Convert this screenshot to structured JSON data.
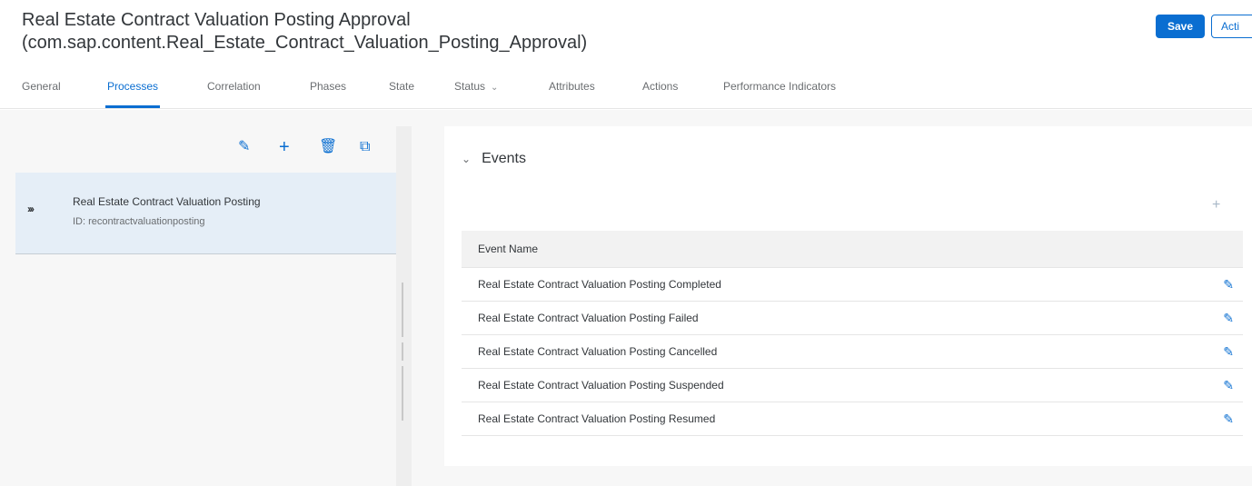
{
  "header": {
    "title_line1": "Real Estate Contract Valuation Posting Approval",
    "title_line2": "(com.sap.content.Real_Estate_Contract_Valuation_Posting_Approval)",
    "save_label": "Save",
    "action_label": "Acti"
  },
  "tabs": [
    {
      "label": "General"
    },
    {
      "label": "Processes"
    },
    {
      "label": "Correlation"
    },
    {
      "label": "Phases"
    },
    {
      "label": "State"
    },
    {
      "label": "Status"
    },
    {
      "label": "Attributes"
    },
    {
      "label": "Actions"
    },
    {
      "label": "Performance Indicators"
    }
  ],
  "active_tab": "Processes",
  "toolbar": {
    "icons": [
      "edit-icon",
      "add-icon",
      "delete-icon",
      "copy-icon"
    ]
  },
  "process": {
    "title": "Real Estate Contract Valuation Posting",
    "id_text": "ID: recontractvaluationposting"
  },
  "events": {
    "section_title": "Events",
    "column_header": "Event Name",
    "rows": [
      "Real Estate Contract Valuation Posting Completed",
      "Real Estate Contract Valuation Posting Failed",
      "Real Estate Contract Valuation Posting Cancelled",
      "Real Estate Contract Valuation Posting Suspended",
      "Real Estate Contract Valuation Posting Resumed"
    ]
  },
  "colors": {
    "accent": "#0a6ed1",
    "selected_row": "#e5eef7",
    "background": "#f7f7f7"
  }
}
